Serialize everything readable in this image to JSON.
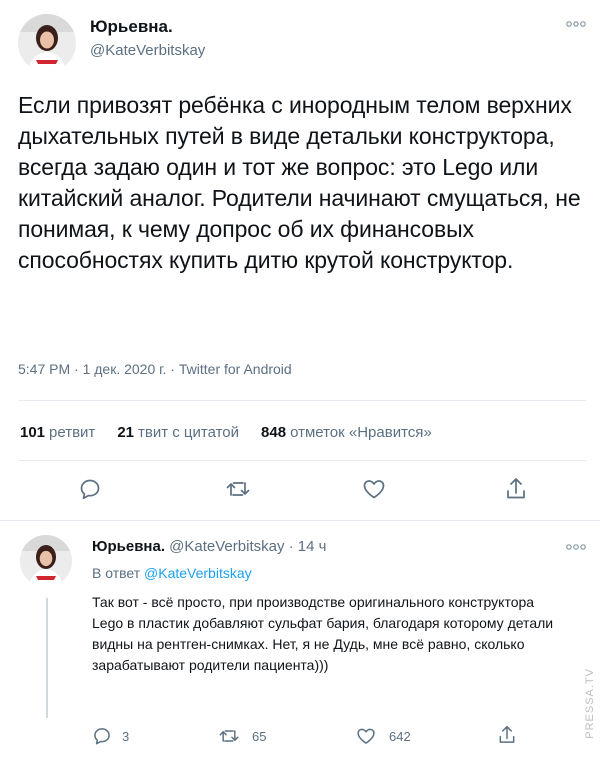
{
  "main_tweet": {
    "display_name": "Юрьевна.",
    "handle": "@KateVerbitskay",
    "text": "Если привозят ребёнка с инородным телом верхних дыхательных путей в виде детальки конструктора, всегда задаю один и тот же вопрос: это Lego или китайский аналог. Родители начинают смущаться, не понимая, к чему допрос об их финансовых способностях купить дитю крутой конструктор.",
    "meta": "5:47 PM · 1 дек. 2020 г. · Twitter for Android",
    "stats": {
      "retweets_count": "101",
      "retweets_label": "ретвит",
      "quotes_count": "21",
      "quotes_label": "твит с цитатой",
      "likes_count": "848",
      "likes_label": "отметок «Нравится»"
    },
    "actions": {
      "reply_icon": "reply-icon",
      "retweet_icon": "retweet-icon",
      "like_icon": "heart-icon",
      "share_icon": "share-icon"
    }
  },
  "reply_tweet": {
    "display_name": "Юрьевна.",
    "handle_time": "@KateVerbitskay · 14 ч",
    "in_reply_prefix": "В ответ",
    "in_reply_handle": "@KateVerbitskay",
    "text": "Так вот - всё просто, при производстве оригинального конструктора Lego в пластик добавляют сульфат бария, благодаря которому детали видны на рентген-снимках. Нет, я не Дудь, мне всё равно, сколько зарабатывают родители пациента)))",
    "actions": {
      "reply_count": "3",
      "retweet_count": "65",
      "like_count": "642"
    }
  },
  "watermark": "PRESSA.TV",
  "colors": {
    "text_primary": "#0f1419",
    "text_secondary": "#5b7083",
    "link": "#1da1f2",
    "divider": "#e6ecf0"
  }
}
